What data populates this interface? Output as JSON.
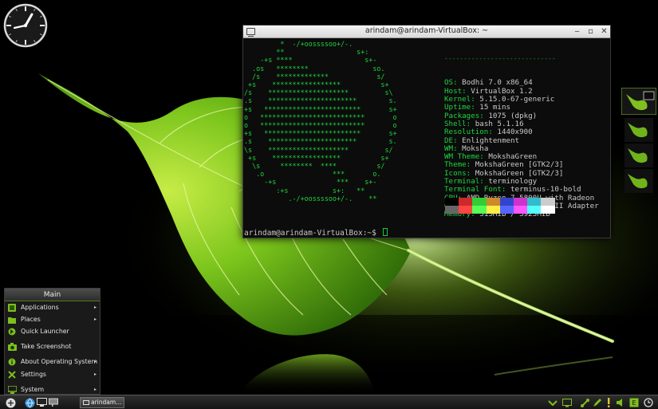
{
  "desktop": {
    "accent_color": "#7fbf1e",
    "terminal_green": "#16cc35"
  },
  "terminal": {
    "title": "arindam@arindam-VirtualBox: ~",
    "logo_lines": [
      "         *  -/+oossssoo+/-.",
      "        **                  s+:",
      "    -+s ****                  s+-",
      "  .os   ********                so.",
      "  /s    *************            s/",
      " +s    *****************          s+",
      "/s    ********************         s\\",
      ".s    **********************        s.",
      "+s   ************************       s+",
      "o   **************************       o",
      "o   **************************       o",
      "+s   ************************       s+",
      ".s    **********************        s.",
      "\\s    ********************         s/",
      " +s    *****************          s+",
      "  \\s     ********  ****          s/",
      "   .o                 ***       o.",
      "     -+s               ***    s+-",
      "        :+s           s+:   **",
      "           .-/+oossssoo+/-.    **"
    ],
    "separator": "-----------------------------",
    "info": [
      {
        "key": "OS",
        "value": "Bodhi 7.0 x86_64"
      },
      {
        "key": "Host",
        "value": "VirtualBox 1.2"
      },
      {
        "key": "Kernel",
        "value": "5.15.0-67-generic"
      },
      {
        "key": "Uptime",
        "value": "15 mins"
      },
      {
        "key": "Packages",
        "value": "1075 (dpkg)"
      },
      {
        "key": "Shell",
        "value": "bash 5.1.16"
      },
      {
        "key": "Resolution",
        "value": "1440x900"
      },
      {
        "key": "DE",
        "value": "Enlightenment"
      },
      {
        "key": "WM",
        "value": "Moksha"
      },
      {
        "key": "WM Theme",
        "value": "MokshaGreen"
      },
      {
        "key": "Theme",
        "value": "MokshaGreen [GTK2/3]"
      },
      {
        "key": "Icons",
        "value": "MokshaGreen [GTK2/3]"
      },
      {
        "key": "Terminal",
        "value": "terminology"
      },
      {
        "key": "Terminal Font",
        "value": "terminus-10-bold"
      },
      {
        "key": "CPU",
        "value": "AMD Ryzen 7 5800U with Radeon"
      },
      {
        "key": "GPU",
        "value": "00:02.0 VMware SVGA II Adapter"
      },
      {
        "key": "Memory",
        "value": "315MiB / 3923MiB"
      }
    ],
    "palette_top": [
      "#000000",
      "#cc2a2a",
      "#33cc33",
      "#cc8a2a",
      "#3344cc",
      "#cc33cc",
      "#33bbcc",
      "#cccccc"
    ],
    "palette_bottom": [
      "#666666",
      "#ff4444",
      "#55ff55",
      "#ffee44",
      "#5566ff",
      "#ff55ff",
      "#55ffff",
      "#ffffff"
    ],
    "prompt": "arindam@arindam-VirtualBox:~$ "
  },
  "menu": {
    "title": "Main",
    "items": [
      {
        "label": "Applications",
        "submenu": true,
        "icon": "applications-icon"
      },
      {
        "label": "Places",
        "submenu": true,
        "icon": "places-icon"
      },
      {
        "label": "Quick Launcher",
        "submenu": false,
        "icon": "quick-launcher-icon"
      },
      {
        "label": "Take Screenshot",
        "submenu": false,
        "icon": "camera-icon"
      },
      {
        "label": "About Operating System",
        "submenu": true,
        "icon": "about-icon"
      },
      {
        "label": "Settings",
        "submenu": true,
        "icon": "settings-icon"
      },
      {
        "label": "System",
        "submenu": true,
        "icon": "system-icon"
      }
    ],
    "arrow": "▸"
  },
  "shelf": {
    "task_label": "arindam...",
    "window_controls": {
      "minimize": "‒",
      "maximize": "▫",
      "close": "✕"
    }
  }
}
